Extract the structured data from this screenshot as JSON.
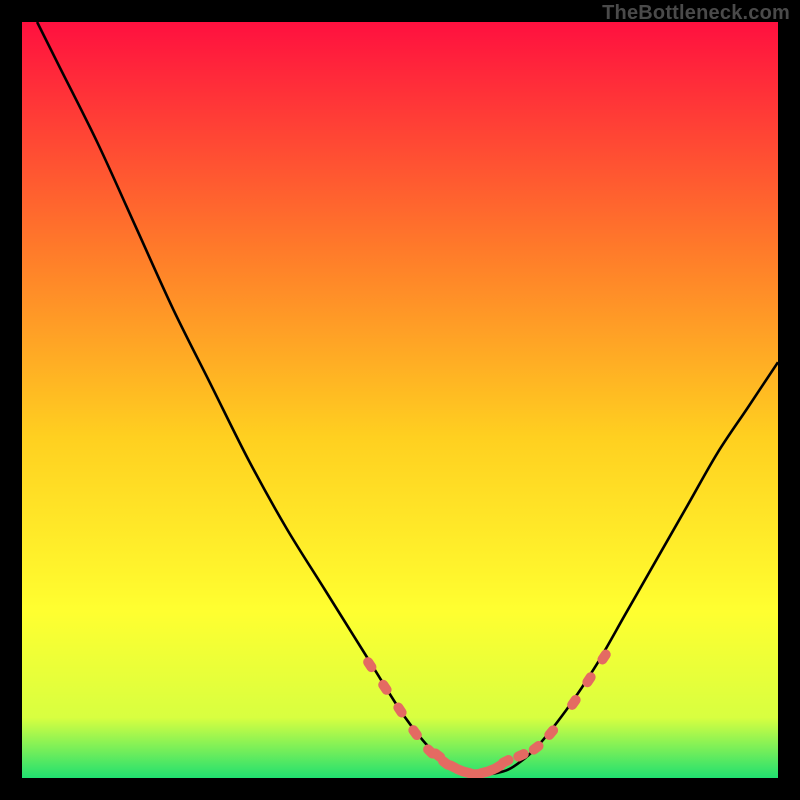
{
  "watermark": "TheBottleneck.com",
  "colors": {
    "frame": "#000000",
    "gradient_top": "#ff103f",
    "gradient_mid1": "#ff7a2a",
    "gradient_mid2": "#ffd020",
    "gradient_mid3": "#ffff30",
    "gradient_low": "#d8ff40",
    "gradient_bottom": "#20e070",
    "curve": "#000000",
    "marker": "#e46a62"
  },
  "chart_data": {
    "type": "line",
    "title": "",
    "xlabel": "",
    "ylabel": "",
    "xlim": [
      0,
      100
    ],
    "ylim": [
      0,
      100
    ],
    "grid": false,
    "series": [
      {
        "name": "bottleneck-curve",
        "x": [
          2,
          5,
          10,
          15,
          20,
          25,
          30,
          35,
          40,
          45,
          50,
          53,
          55,
          57,
          59,
          61,
          63,
          65,
          68,
          72,
          76,
          80,
          84,
          88,
          92,
          96,
          100
        ],
        "y": [
          100,
          94,
          84,
          73,
          62,
          52,
          42,
          33,
          25,
          17,
          9,
          5,
          3,
          1.5,
          0.7,
          0.5,
          0.7,
          1.5,
          4,
          9,
          15,
          22,
          29,
          36,
          43,
          49,
          55
        ]
      }
    ],
    "markers": {
      "name": "highlighted-segment",
      "x": [
        46,
        48,
        50,
        52,
        54,
        55,
        56,
        57,
        58,
        59,
        60,
        61,
        62,
        63,
        64,
        66,
        68,
        70,
        73,
        75,
        77
      ],
      "y": [
        15,
        12,
        9,
        6,
        3.5,
        3,
        2,
        1.5,
        1,
        0.7,
        0.5,
        0.7,
        1,
        1.5,
        2.2,
        3,
        4,
        6,
        10,
        13,
        16
      ]
    }
  }
}
